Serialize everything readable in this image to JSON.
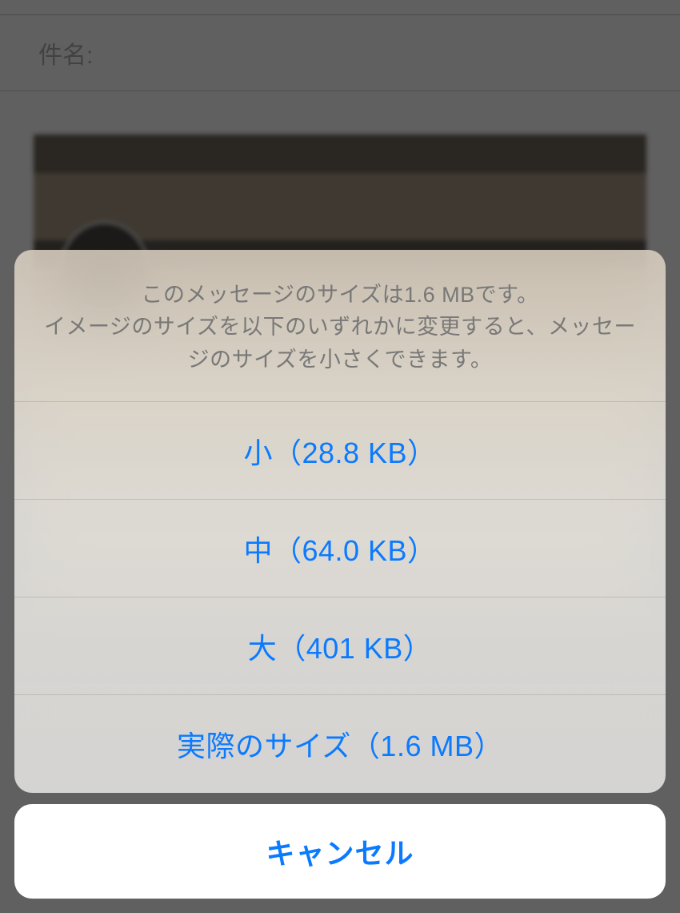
{
  "background": {
    "subject_label": "件名:"
  },
  "sheet": {
    "message_line1": "このメッセージのサイズは1.6 MBです。",
    "message_line2": "イメージのサイズを以下のいずれかに変更すると、メッセージのサイズを小さくできます。",
    "options": [
      {
        "label": "小（28.8 KB）"
      },
      {
        "label": "中（64.0 KB）"
      },
      {
        "label": "大（401 KB）"
      },
      {
        "label": "実際のサイズ（1.6 MB）"
      }
    ],
    "cancel_label": "キャンセル"
  }
}
